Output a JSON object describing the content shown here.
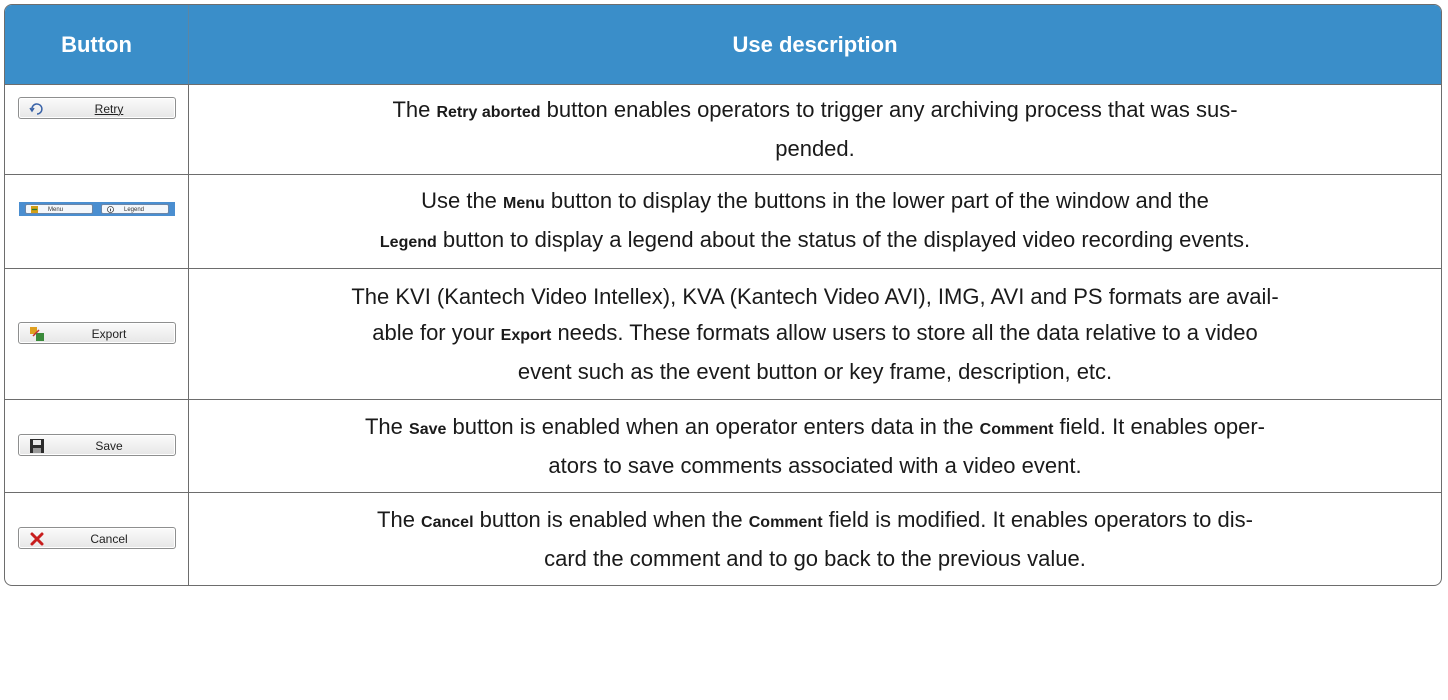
{
  "headers": {
    "button": "Button",
    "description": "Use description"
  },
  "rows": [
    {
      "button_label": "Retry",
      "button_icon": "retry-icon",
      "parts": [
        "The ",
        "Retry aborted",
        " button enables operators to trigger any archiving process that was sus-",
        "pended."
      ]
    },
    {
      "button_labels": [
        "Menu",
        "Legend"
      ],
      "parts": [
        "Use the ",
        "Menu",
        " button to display the buttons in the lower part of the window and the",
        "Legend",
        " button to display a legend about the status of the displayed video recording events."
      ]
    },
    {
      "button_label": "Export",
      "button_icon": "export-icon",
      "parts": [
        "The KVI (Kantech Video Intellex), KVA (Kantech Video AVI), IMG, AVI and PS formats are avail-",
        "able for your ",
        "Export",
        " needs. These formats allow users to store all the data relative to a video",
        "event such as the event button or key frame, description, etc."
      ]
    },
    {
      "button_label": "Save",
      "button_icon": "save-icon",
      "parts": [
        "The ",
        "Save",
        " button is enabled when an operator enters data in the ",
        "Comment",
        " field. It enables oper-",
        "ators to save comments associated with a video event."
      ]
    },
    {
      "button_label": "Cancel",
      "button_icon": "cancel-icon",
      "parts": [
        "The ",
        "Cancel",
        " button is enabled when the ",
        "Comment",
        " field is modified. It enables operators to dis-",
        "card the comment and to go back to the previous value."
      ]
    }
  ],
  "colors": {
    "header_bg": "#3a8ec9",
    "header_text": "#ffffff",
    "border": "#6d6d6d"
  }
}
